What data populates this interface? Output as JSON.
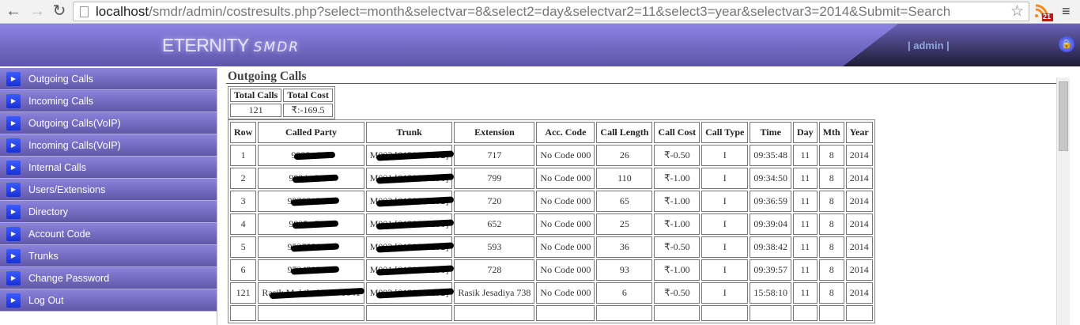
{
  "browser": {
    "url_host": "localhost",
    "url_rest": "/smdr/admin/costresults.php?select=month&selectvar=8&select2=day&selectvar2=11&select3=year&selectvar3=2014&Submit=Search",
    "rss_badge": "21"
  },
  "header": {
    "logo_main": "ETERNITY",
    "logo_sub": "SMDR",
    "user": "| admin |"
  },
  "sidebar": {
    "items": [
      {
        "label": "Outgoing Calls"
      },
      {
        "label": "Incoming Calls"
      },
      {
        "label": "Outgoing Calls(VoIP)"
      },
      {
        "label": "Incoming Calls(VoIP)"
      },
      {
        "label": "Internal Calls"
      },
      {
        "label": "Users/Extensions"
      },
      {
        "label": "Directory"
      },
      {
        "label": "Account Code"
      },
      {
        "label": "Trunks"
      },
      {
        "label": "Change Password"
      },
      {
        "label": "Log Out"
      }
    ]
  },
  "main": {
    "title": "Outgoing Calls",
    "totals": {
      "headers": [
        "Total Calls",
        "Total Cost"
      ],
      "values": [
        "121",
        "₹:-169.5"
      ]
    },
    "table": {
      "headers": [
        "Row",
        "Called Party",
        "Trunk",
        "Extension",
        "Acc. Code",
        "Call Length",
        "Call Cost",
        "Call Type",
        "Time",
        "Day",
        "Mth",
        "Year"
      ],
      "rows": [
        [
          "1",
          "9828••368",
          "M002 [8120680292]",
          "717",
          "No Code 000",
          "26",
          "₹-0.50",
          "I",
          "09:35:48",
          "11",
          "8",
          "2014"
        ],
        [
          "2",
          "9824••2136",
          "M001 [8120680291]",
          "799",
          "No Code 000",
          "110",
          "₹-1.00",
          "I",
          "09:34:50",
          "11",
          "8",
          "2014"
        ],
        [
          "3",
          "9978213457",
          "M002 [8120680292]",
          "720",
          "No Code 000",
          "65",
          "₹-1.00",
          "I",
          "09:36:59",
          "11",
          "8",
          "2014"
        ],
        [
          "4",
          "9825••7030",
          "M001 [8120680291]",
          "652",
          "No Code 000",
          "25",
          "₹-1.00",
          "I",
          "09:39:04",
          "11",
          "8",
          "2014"
        ],
        [
          "5",
          "9537558385",
          "M002 [8120680292]",
          "593",
          "No Code 000",
          "36",
          "₹-0.50",
          "I",
          "09:38:42",
          "11",
          "8",
          "2014"
        ],
        [
          "6",
          "9724302156",
          "M001 [8120680291]",
          "728",
          "No Code 000",
          "93",
          "₹-1.00",
          "I",
          "09:39:57",
          "11",
          "8",
          "2014"
        ],
        [
          "121",
          "Rasik Mobile 9879••0041",
          "M002 [8120680292]",
          "Rasik Jesadiya 738",
          "No Code 000",
          "6",
          "₹-0.50",
          "I",
          "15:58:10",
          "11",
          "8",
          "2014"
        ]
      ]
    }
  }
}
